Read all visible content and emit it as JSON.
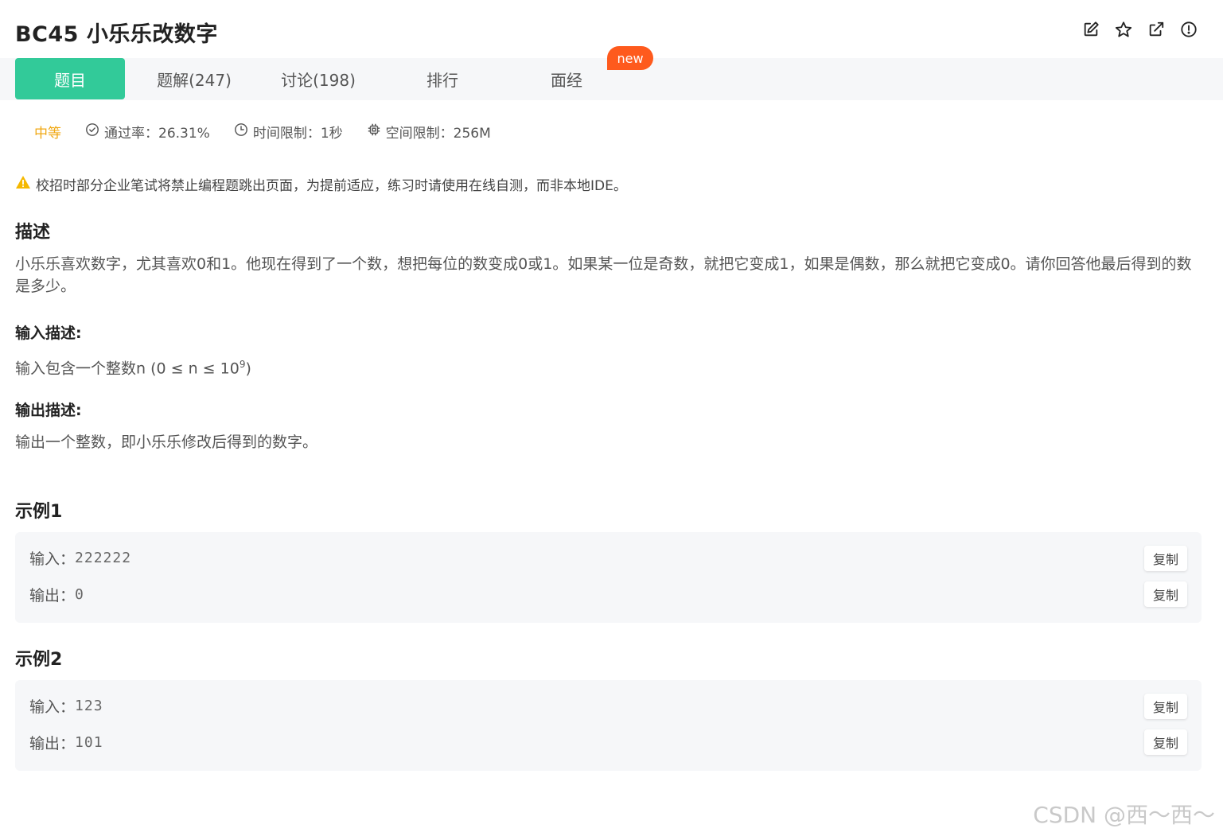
{
  "header": {
    "title": "BC45  小乐乐改数字",
    "tools": [
      {
        "name": "edit-icon"
      },
      {
        "name": "star-icon"
      },
      {
        "name": "external-link-icon"
      },
      {
        "name": "report-icon"
      }
    ]
  },
  "tabs": [
    {
      "label": "题目",
      "active": true
    },
    {
      "label": "题解(247)"
    },
    {
      "label": "讨论(198)"
    },
    {
      "label": "排行"
    },
    {
      "label": "面经"
    }
  ],
  "new_badge": "new",
  "meta": {
    "difficulty": "中等",
    "pass_rate": "通过率：26.31%",
    "time_limit": "时间限制：1秒",
    "memory_limit": "空间限制：256M"
  },
  "notice": "校招时部分企业笔试将禁止编程题跳出页面，为提前适应，练习时请使用在线自测，而非本地IDE。",
  "description": {
    "heading": "描述",
    "text": "小乐乐喜欢数字，尤其喜欢0和1。他现在得到了一个数，想把每位的数变成0或1。如果某一位是奇数，就把它变成1，如果是偶数，那么就把它变成0。请你回答他最后得到的数是多少。"
  },
  "input_desc": {
    "heading": "输入描述:",
    "text_before": "输入包含一个整数n (0 ≤ n ≤ 10",
    "sup": "9",
    "text_after": ")"
  },
  "output_desc": {
    "heading": "输出描述:",
    "text": "输出一个整数，即小乐乐修改后得到的数字。"
  },
  "examples": [
    {
      "heading": "示例1",
      "input_label": "输入：",
      "input": "222222",
      "output_label": "输出：",
      "output": "0"
    },
    {
      "heading": "示例2",
      "input_label": "输入：",
      "input": "123",
      "output_label": "输出：",
      "output": "101"
    }
  ],
  "copy_label": "复制",
  "watermark": "CSDN @西～西～",
  "colors": {
    "accent": "#32ca99",
    "badge": "#fe5a1d",
    "difficulty": "#f0a814",
    "warning": "#f5b800"
  }
}
